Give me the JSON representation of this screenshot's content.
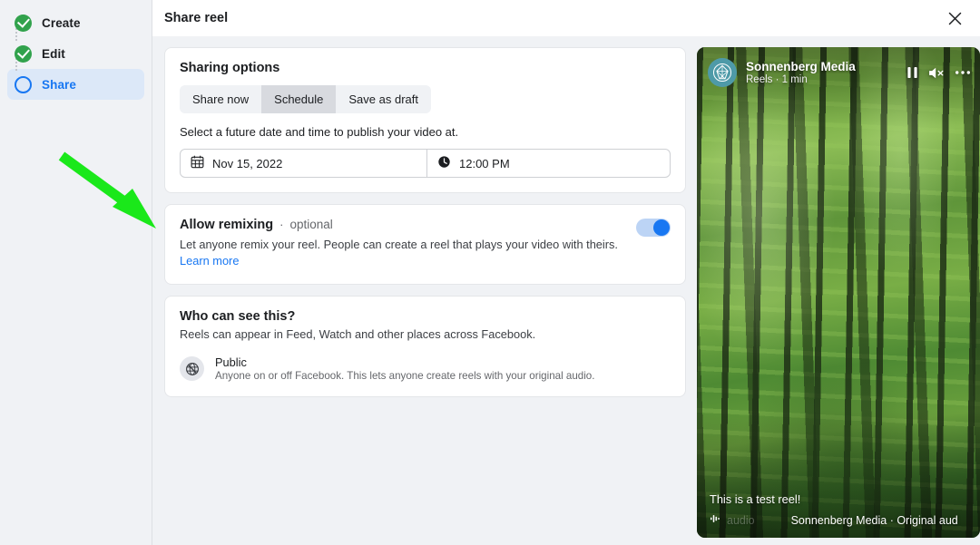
{
  "window": {
    "title": "Share reel",
    "close_icon": "close-icon"
  },
  "sidebar": {
    "steps": [
      {
        "label": "Create",
        "state": "done",
        "icon": "check-circle-icon"
      },
      {
        "label": "Edit",
        "state": "done",
        "icon": "check-circle-icon"
      },
      {
        "label": "Share",
        "state": "current",
        "icon": "circle-outline-icon"
      }
    ]
  },
  "sharing_options": {
    "title": "Sharing options",
    "tabs": [
      {
        "label": "Share now",
        "selected": false
      },
      {
        "label": "Schedule",
        "selected": true
      },
      {
        "label": "Save as draft",
        "selected": false
      }
    ],
    "helper_text": "Select a future date and time to publish your video at.",
    "date": {
      "icon": "calendar-icon",
      "value": "Nov 15, 2022"
    },
    "time": {
      "icon": "clock-icon",
      "value": "12:00 PM"
    }
  },
  "allow_remixing": {
    "title": "Allow remixing",
    "separator": "·",
    "optional_label": "optional",
    "description": "Let anyone remix your reel. People can create a reel that plays your video with theirs.",
    "learn_more": "Learn more",
    "toggle_on": true
  },
  "audience": {
    "title": "Who can see this?",
    "subtitle": "Reels can appear in Feed, Watch and other places across Facebook.",
    "option": {
      "icon": "globe-icon",
      "name": "Public",
      "description": "Anyone on or off Facebook. This lets anyone create reels with your original audio."
    }
  },
  "preview": {
    "account_name": "Sonnenberg Media",
    "meta": "Reels · 1 min",
    "avatar_icon": "brand-logo-icon",
    "controls": [
      {
        "icon": "pause-icon"
      },
      {
        "icon": "mute-icon"
      },
      {
        "icon": "more-options-icon"
      }
    ],
    "caption": "This is a test reel!",
    "audio_icon": "audio-wave-icon",
    "audio_ghost_text": "audio",
    "audio_text": "Sonnenberg Media · Original aud"
  },
  "annotation": {
    "arrow_color": "#1AE81A",
    "points_to": "Allow remixing"
  },
  "colors": {
    "accent_blue": "#1877f2",
    "success_green": "#31a24c",
    "page_bg": "#f0f2f5",
    "card_bg": "#ffffff",
    "avatar_teal": "#4e9aa8"
  }
}
